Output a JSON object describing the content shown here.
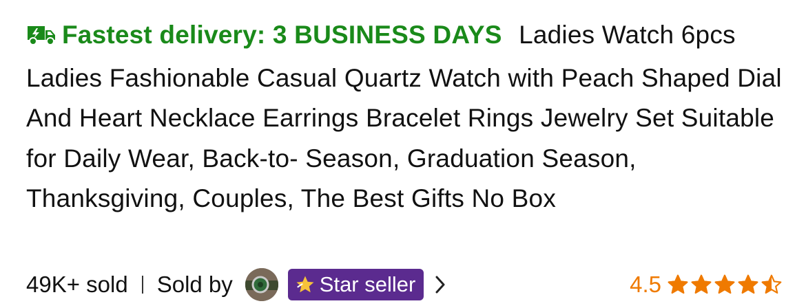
{
  "product": {
    "delivery": "Fastest delivery: 3 BUSINESS DAYS",
    "title": "Ladies Watch 6pcs Ladies Fashionable Casual Quartz Watch with Peach Shaped Dial And Heart Necklace Earrings Bracelet Rings Jewelry Set Suitable for Daily Wear, Back-to- Season, Graduation Season, Thanksgiving, Couples, The Best Gifts No Box"
  },
  "meta": {
    "sold": "49K+ sold",
    "sold_by": "Sold by",
    "badge": "Star seller",
    "rating": "4.5",
    "rating_value": 4.5,
    "rating_max": 5
  },
  "colors": {
    "delivery": "#1a8a1a",
    "badge_bg": "#5b2b8f",
    "rating": "#ef7a00"
  },
  "icons": [
    "truck-icon",
    "seller-avatar",
    "star-badge-icon",
    "chevron-right-icon",
    "star-icon"
  ]
}
